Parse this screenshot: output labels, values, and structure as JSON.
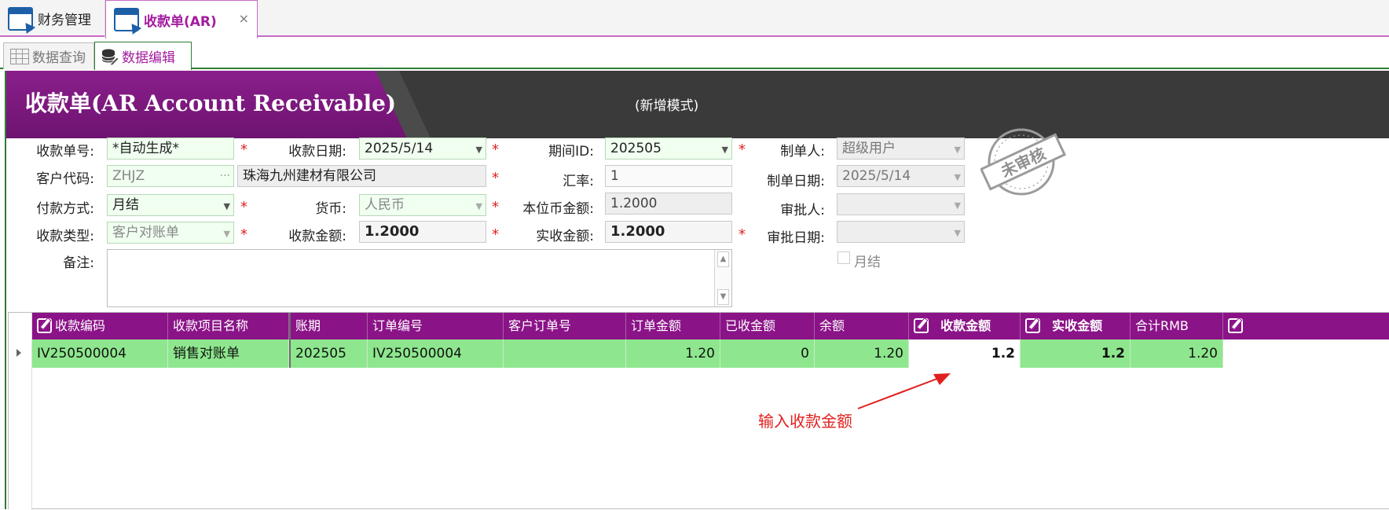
{
  "doc_tabs": [
    {
      "label": "财务管理"
    },
    {
      "label": "收款单(AR)",
      "close": "×"
    }
  ],
  "sub_tabs": [
    {
      "label": "数据查询"
    },
    {
      "label": "数据编辑"
    }
  ],
  "banner": {
    "title": "收款单(AR Account Receivable)",
    "mode": "(新增模式)"
  },
  "form": {
    "receipt_no": {
      "label": "收款单号:",
      "value": "*自动生成*"
    },
    "receipt_date": {
      "label": "收款日期:",
      "value": "2025/5/14"
    },
    "period_id": {
      "label": "期间ID:",
      "value": "202505"
    },
    "creator": {
      "label": "制单人:",
      "value": "超级用户"
    },
    "customer_code": {
      "label": "客户代码:",
      "value": "ZHJZ",
      "name": "珠海九州建材有限公司"
    },
    "exchange_rate": {
      "label": "汇率:",
      "value": "1"
    },
    "create_date": {
      "label": "制单日期:",
      "value": "2025/5/14"
    },
    "payment_method": {
      "label": "付款方式:",
      "value": "月结"
    },
    "currency": {
      "label": "货币:",
      "value": "人民币"
    },
    "local_amount": {
      "label": "本位币金额:",
      "value": "1.2000"
    },
    "approver": {
      "label": "审批人:",
      "value": ""
    },
    "receipt_type": {
      "label": "收款类型:",
      "value": "客户对账单"
    },
    "receipt_amount": {
      "label": "收款金额:",
      "value": "1.2000"
    },
    "actual_amount": {
      "label": "实收金额:",
      "value": "1.2000"
    },
    "approve_date": {
      "label": "审批日期:",
      "value": ""
    },
    "remark": {
      "label": "备注:",
      "value": ""
    },
    "monthly_checkbox": {
      "label": "月结",
      "checked": false
    },
    "required_mark": "*",
    "stamp_text": "未审核"
  },
  "grid": {
    "columns": [
      {
        "label": "收款编码",
        "editable": true
      },
      {
        "label": "收款项目名称"
      },
      {
        "label": "账期"
      },
      {
        "label": "订单编号"
      },
      {
        "label": "客户订单号"
      },
      {
        "label": "订单金额"
      },
      {
        "label": "已收金额"
      },
      {
        "label": "余额"
      },
      {
        "label": "收款金额",
        "editable": true
      },
      {
        "label": "实收金额",
        "editable": true
      },
      {
        "label": "合计RMB"
      }
    ],
    "rows": [
      {
        "code": "IV250500004",
        "item_name": "销售对账单",
        "period": "202505",
        "order_no": "IV250500004",
        "customer_order_no": "",
        "order_amount": "1.20",
        "received": "0",
        "balance": "1.20",
        "receipt_amount": "1.2",
        "actual_amount": "1.2",
        "total_rmb": "1.20"
      }
    ]
  },
  "annotation": {
    "text": "输入收款金额",
    "color": "#e0201e"
  },
  "colors": {
    "accent": "#8b1388",
    "row_highlight": "#8ee78e",
    "required_field": "#f0fff0"
  }
}
